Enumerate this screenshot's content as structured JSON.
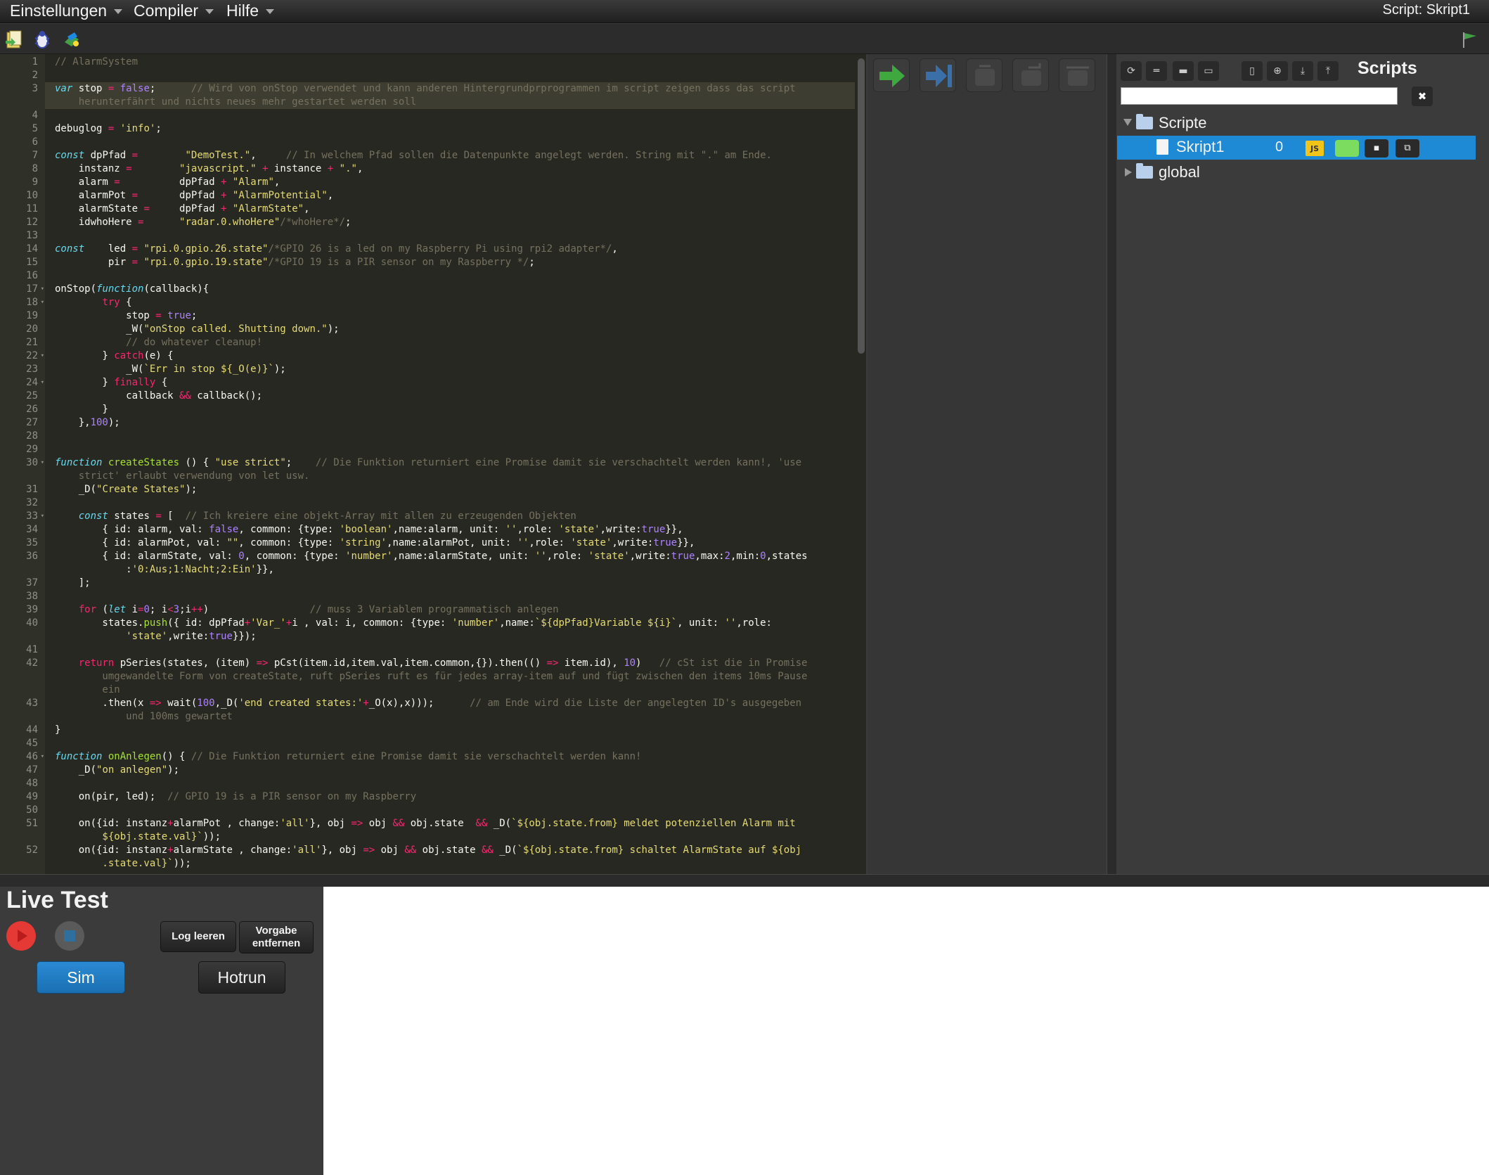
{
  "menu": {
    "items": [
      {
        "label": "Einstellungen"
      },
      {
        "label": "Compiler"
      },
      {
        "label": "Hilfe"
      }
    ],
    "script_title": "Script: Skript1"
  },
  "editor": {
    "lines": [
      {
        "n": "1"
      },
      {
        "n": "2"
      },
      {
        "n": "3"
      },
      {
        "n": ""
      },
      {
        "n": "4"
      },
      {
        "n": "5"
      },
      {
        "n": "6"
      },
      {
        "n": "7"
      },
      {
        "n": "8"
      },
      {
        "n": "9"
      },
      {
        "n": "10"
      },
      {
        "n": "11"
      },
      {
        "n": "12"
      },
      {
        "n": "13"
      },
      {
        "n": "14"
      },
      {
        "n": "15"
      },
      {
        "n": "16"
      },
      {
        "n": "17",
        "fold": true
      },
      {
        "n": "18",
        "fold": true
      },
      {
        "n": "19"
      },
      {
        "n": "20"
      },
      {
        "n": "21"
      },
      {
        "n": "22",
        "fold": true
      },
      {
        "n": "23"
      },
      {
        "n": "24",
        "fold": true
      },
      {
        "n": "25"
      },
      {
        "n": "26"
      },
      {
        "n": "27"
      },
      {
        "n": "28"
      },
      {
        "n": "29"
      },
      {
        "n": "30",
        "fold": true
      },
      {
        "n": ""
      },
      {
        "n": "31"
      },
      {
        "n": "32"
      },
      {
        "n": "33",
        "fold": true
      },
      {
        "n": "34"
      },
      {
        "n": "35"
      },
      {
        "n": "36"
      },
      {
        "n": ""
      },
      {
        "n": "37"
      },
      {
        "n": "38"
      },
      {
        "n": "39"
      },
      {
        "n": "40"
      },
      {
        "n": ""
      },
      {
        "n": "41"
      },
      {
        "n": "42"
      },
      {
        "n": ""
      },
      {
        "n": ""
      },
      {
        "n": "43"
      },
      {
        "n": ""
      },
      {
        "n": "44"
      },
      {
        "n": "45"
      },
      {
        "n": "46",
        "fold": true
      },
      {
        "n": "47"
      },
      {
        "n": "48"
      },
      {
        "n": "49"
      },
      {
        "n": "50"
      },
      {
        "n": "51"
      },
      {
        "n": ""
      },
      {
        "n": "52"
      },
      {
        "n": ""
      }
    ]
  },
  "scripts_panel": {
    "title": "Scripts",
    "filter_value": "",
    "filter_clear": "✖",
    "tree": {
      "root_folder": "Scripte",
      "script_name": "Skript1",
      "script_count": "0",
      "script_lang": "JS",
      "global_folder": "global"
    }
  },
  "live_test": {
    "title": "Live Test",
    "log_clear_label": "Log leeren",
    "remove_default_label_1": "Vorgabe",
    "remove_default_label_2": "entfernen",
    "sim_label": "Sim",
    "hotrun_label": "Hotrun"
  },
  "colors": {
    "accent": "#1e8ad6",
    "editor_bg": "#272822",
    "run_green": "#3fa83f",
    "record_red": "#e53935"
  }
}
